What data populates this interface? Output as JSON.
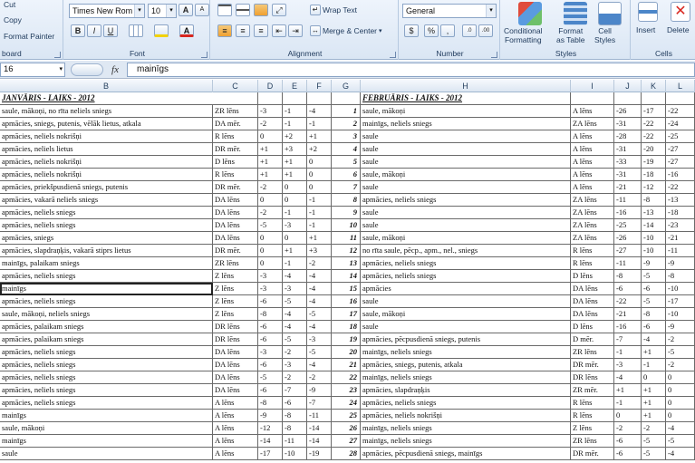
{
  "ribbon": {
    "clipboard": {
      "cut": "Cut",
      "copy": "Copy",
      "format_painter": "Format Painter",
      "label": "board"
    },
    "font": {
      "name": "Times New Rom",
      "size": "10",
      "bold": "B",
      "italic": "I",
      "underline": "U",
      "grow": "A",
      "shrink": "A",
      "label": "Font"
    },
    "alignment": {
      "wrap_text": "Wrap Text",
      "merge_center": "Merge & Center",
      "label": "Alignment"
    },
    "number": {
      "format": "General",
      "currency": "$",
      "percent": "%",
      "comma": ",",
      "label": "Number"
    },
    "styles": {
      "conditional": "Conditional Formatting",
      "conditional_l1": "Conditional",
      "conditional_l2": "Formatting",
      "format_table_l1": "Format",
      "format_table_l2": "as Table",
      "cell_styles_l1": "Cell",
      "cell_styles_l2": "Styles",
      "label": "Styles"
    },
    "cells": {
      "insert": "Insert",
      "delete": "Delete",
      "label": "Cells"
    }
  },
  "formula_bar": {
    "name_box": "16",
    "fx": "fx",
    "value": "mainīgs"
  },
  "columns": [
    "B",
    "C",
    "D",
    "E",
    "F",
    "G",
    "H",
    "I",
    "J",
    "K",
    "L"
  ],
  "titles": {
    "jan": "JANVĀRIS - LAIKS - 2012",
    "feb": "FEBRUĀRIS - LAIKS - 2012"
  },
  "rows": [
    [
      "saule, mākoņi, no rīta neliels sniegs",
      "ZR lēns",
      "-3",
      "-1",
      "-4",
      "1",
      "saule, mākoņi",
      "A lēns",
      "-26",
      "-17",
      "-22"
    ],
    [
      "apmācies, sniegs, putenis, vēlāk lietus, atkala",
      "DA mēr.",
      "-2",
      "-1",
      "-1",
      "2",
      "mainīgs, neliels sniegs",
      "ZA lēns",
      "-31",
      "-22",
      "-24"
    ],
    [
      "apmācies, neliels nokrišņi",
      "R lēns",
      "0",
      "+2",
      "+1",
      "3",
      "saule",
      "A lēns",
      "-28",
      "-22",
      "-25"
    ],
    [
      "apmācies, neliels lietus",
      "DR mēr.",
      "+1",
      "+3",
      "+2",
      "4",
      "saule",
      "A lēns",
      "-31",
      "-20",
      "-27"
    ],
    [
      "apmācies, neliels nokrišņi",
      "D lēns",
      "+1",
      "+1",
      "0",
      "5",
      "saule",
      "A lēns",
      "-33",
      "-19",
      "-27"
    ],
    [
      "apmācies, neliels nokrišņi",
      "R lēns",
      "+1",
      "+1",
      "0",
      "6",
      "saule, mākoņi",
      "A lēns",
      "-31",
      "-18",
      "-16"
    ],
    [
      "apmācies, priekšpusdienā sniegs, putenis",
      "DR mēr.",
      "-2",
      "0",
      "0",
      "7",
      "saule",
      "A lēns",
      "-21",
      "-12",
      "-22"
    ],
    [
      "apmācies, vakarā neliels sniegs",
      "DA lēns",
      "0",
      "0",
      "-1",
      "8",
      "apmācies, neliels sniegs",
      "ZA lēns",
      "-11",
      "-8",
      "-13"
    ],
    [
      "apmācies, neliels sniegs",
      "DA lēns",
      "-2",
      "-1",
      "-1",
      "9",
      "saule",
      "ZA lēns",
      "-16",
      "-13",
      "-18"
    ],
    [
      "apmācies, neliels sniegs",
      "DA lēns",
      "-5",
      "-3",
      "-1",
      "10",
      "saule",
      "ZA lēns",
      "-25",
      "-14",
      "-23"
    ],
    [
      "apmācies, sniegs",
      "DA lēns",
      "0",
      "0",
      "+1",
      "11",
      "saule, mākoņi",
      "ZA lēns",
      "-26",
      "-10",
      "-21"
    ],
    [
      "apmācies, slapdraņķis, vakarā stiprs lietus",
      "DR mēr.",
      "0",
      "+1",
      "+3",
      "12",
      "no rīta saule, pēcp., apm., nel., sniegs",
      "R lēns",
      "-27",
      "-10",
      "-11"
    ],
    [
      "mainīgs, palaikam sniegs",
      "ZR lēns",
      "0",
      "-1",
      "-2",
      "13",
      "apmācies, neliels sniegs",
      "R lēns",
      "-11",
      "-9",
      "-9"
    ],
    [
      "apmācies, neliels sniegs",
      "Z lēns",
      "-3",
      "-4",
      "-4",
      "14",
      "apmācies, neliels sniegs",
      "D lēns",
      "-8",
      "-5",
      "-8"
    ],
    [
      "mainīgs",
      "Z lēns",
      "-3",
      "-3",
      "-4",
      "15",
      "apmācies",
      "DA lēns",
      "-6",
      "-6",
      "-10"
    ],
    [
      "apmācies, neliels sniegs",
      "Z lēns",
      "-6",
      "-5",
      "-4",
      "16",
      "saule",
      "DA lēns",
      "-22",
      "-5",
      "-17"
    ],
    [
      "saule, mākoņi, neliels sniegs",
      "Z lēns",
      "-8",
      "-4",
      "-5",
      "17",
      "saule, mākoņi",
      "DA lēns",
      "-21",
      "-8",
      "-10"
    ],
    [
      "apmācies, palaikam sniegs",
      "DR lēns",
      "-6",
      "-4",
      "-4",
      "18",
      "saule",
      "D lēns",
      "-16",
      "-6",
      "-9"
    ],
    [
      "apmācies, palaikam sniegs",
      "DR lēns",
      "-6",
      "-5",
      "-3",
      "19",
      "apmācies, pēcpusdienā sniegs, putenis",
      "D mēr.",
      "-7",
      "-4",
      "-2"
    ],
    [
      "apmācies, neliels sniegs",
      "DA lēns",
      "-3",
      "-2",
      "-5",
      "20",
      "mainīgs, neliels sniegs",
      "ZR lēns",
      "-1",
      "+1",
      "-5"
    ],
    [
      "apmācies, neliels sniegs",
      "DA lēns",
      "-6",
      "-3",
      "-4",
      "21",
      "apmācies, sniegs, putenis, atkala",
      "DR mēr.",
      "-3",
      "-1",
      "-2"
    ],
    [
      "apmācies, neliels sniegs",
      "DA lēns",
      "-5",
      "-2",
      "-2",
      "22",
      "mainīgs, neliels sniegs",
      "DR lēns",
      "-4",
      "0",
      "0"
    ],
    [
      "apmācies, neliels sniegs",
      "DA lēns",
      "-6",
      "-7",
      "-9",
      "23",
      "apmācies, slapdraņķis",
      "ZR mēr.",
      "+1",
      "+1",
      "0"
    ],
    [
      "apmācies, neliels sniegs",
      "A lēns",
      "-8",
      "-6",
      "-7",
      "24",
      "apmācies, neliels sniegs",
      "R lēns",
      "-1",
      "+1",
      "0"
    ],
    [
      "mainīgs",
      "A lēns",
      "-9",
      "-8",
      "-11",
      "25",
      "apmācies, neliels nokrišņi",
      "R lēns",
      "0",
      "+1",
      "0"
    ],
    [
      "saule, mākoņi",
      "A lēns",
      "-12",
      "-8",
      "-14",
      "26",
      "mainīgs, neliels sniegs",
      "Z lēns",
      "-2",
      "-2",
      "-4"
    ],
    [
      "mainīgs",
      "A lēns",
      "-14",
      "-11",
      "-14",
      "27",
      "mainīgs, neliels sniegs",
      "ZR lēns",
      "-6",
      "-5",
      "-5"
    ],
    [
      "saule",
      "A lēns",
      "-17",
      "-10",
      "-19",
      "28",
      "apmācies, pēcpusdienā sniegs, mainīgs",
      "DR mēr.",
      "-6",
      "-5",
      "-4"
    ]
  ],
  "colors": {
    "ribbon_top": "#eef4fc",
    "ribbon_bottom": "#dae6f4",
    "header_text": "#27415f",
    "accent": "#1e395b"
  }
}
